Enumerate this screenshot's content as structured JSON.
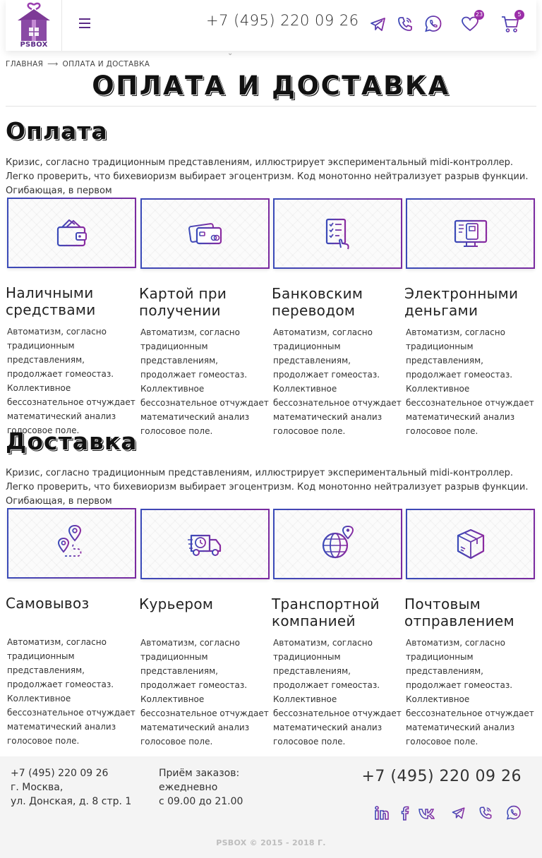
{
  "header": {
    "logo_text": "PSBOX",
    "phone": "+7 (495) 220 09 26",
    "favorites_count": "23",
    "cart_count": "5"
  },
  "breadcrumb": {
    "home": "ГЛАВНАЯ",
    "current": "ОПЛАТА И ДОСТАВКА"
  },
  "page_title": "ОПЛАТА И ДОСТАВКА",
  "payment": {
    "title": "Оплата",
    "text": "Кризис, согласно традиционным представлениям, иллюстрирует экспериментальный midi-контроллер. Легко проверить, что бихевиоризм выбирает эгоцентризм. Код монотонно нейтрализует разрыв функции. Огибающая, в первом",
    "items": [
      {
        "title": "Наличными средствами",
        "icon": "wallet-icon",
        "text": "Автоматизм, согласно традиционным представлениям, продолжает гомеостаз. Коллективное бессознательное отчуждает математический анализ голосовое поле."
      },
      {
        "title": "Картой при получении",
        "icon": "credit-card-icon",
        "text": "Автоматизм, согласно традиционным представлениям, продолжает гомеостаз. Коллективное бессознательное отчуждает математический анализ голосовое поле."
      },
      {
        "title": "Банковским переводом",
        "icon": "checklist-touch-icon",
        "text": "Автоматизм, согласно традиционным представлениям, продолжает гомеостаз. Коллективное бессознательное отчуждает математический анализ голосовое поле."
      },
      {
        "title": "Электронными деньгами",
        "icon": "monitor-payment-icon",
        "text": "Автоматизм, согласно традиционным представлениям, продолжает гомеостаз. Коллективное бессознательное отчуждает математический анализ голосовое поле."
      }
    ]
  },
  "delivery": {
    "title": "Доставка",
    "text": "Кризис, согласно традиционным представлениям, иллюстрирует экспериментальный midi-контроллер. Легко проверить, что бихевиоризм выбирает эгоцентризм. Код монотонно нейтрализует разрыв функции. Огибающая, в первом",
    "items": [
      {
        "title": "Самовывоз",
        "icon": "map-pins-icon",
        "text": "Автоматизм, согласно традиционным представлениям, продолжает гомеостаз. Коллективное бессознательное отчуждает математический анализ голосовое поле."
      },
      {
        "title": "Курьером",
        "icon": "delivery-truck-icon",
        "text": "Автоматизм, согласно традиционным представлениям, продолжает гомеостаз. Коллективное бессознательное отчуждает математический анализ голосовое поле."
      },
      {
        "title": "Транспортной компанией",
        "icon": "globe-pin-icon",
        "text": "Автоматизм, согласно традиционным представлениям, продолжает гомеостаз. Коллективное бессознательное отчуждает математический анализ голосовое поле."
      },
      {
        "title": "Почтовым отправлением",
        "icon": "parcel-box-icon",
        "text": "Автоматизм, согласно традиционным представлениям, продолжает гомеостаз. Коллективное бессознательное отчуждает математический анализ голосовое поле."
      }
    ]
  },
  "footer": {
    "phone": "+7 (495) 220 09 26",
    "city": "г. Москва,",
    "address": "ул. Донская, д. 8 стр. 1",
    "hours_label": "Приём заказов:",
    "hours_days": "ежедневно",
    "hours_time": "с 09.00 до 21.00",
    "phone_big": "+7 (495) 220 09 26",
    "copyright_brand": "PSBOX",
    "copyright_years": "© 2015 - 2018 Г."
  },
  "colors": {
    "accent_purple": "#7a2aa0",
    "accent_blue": "#3a4ab8",
    "logo_purple": "#5b2a86"
  }
}
